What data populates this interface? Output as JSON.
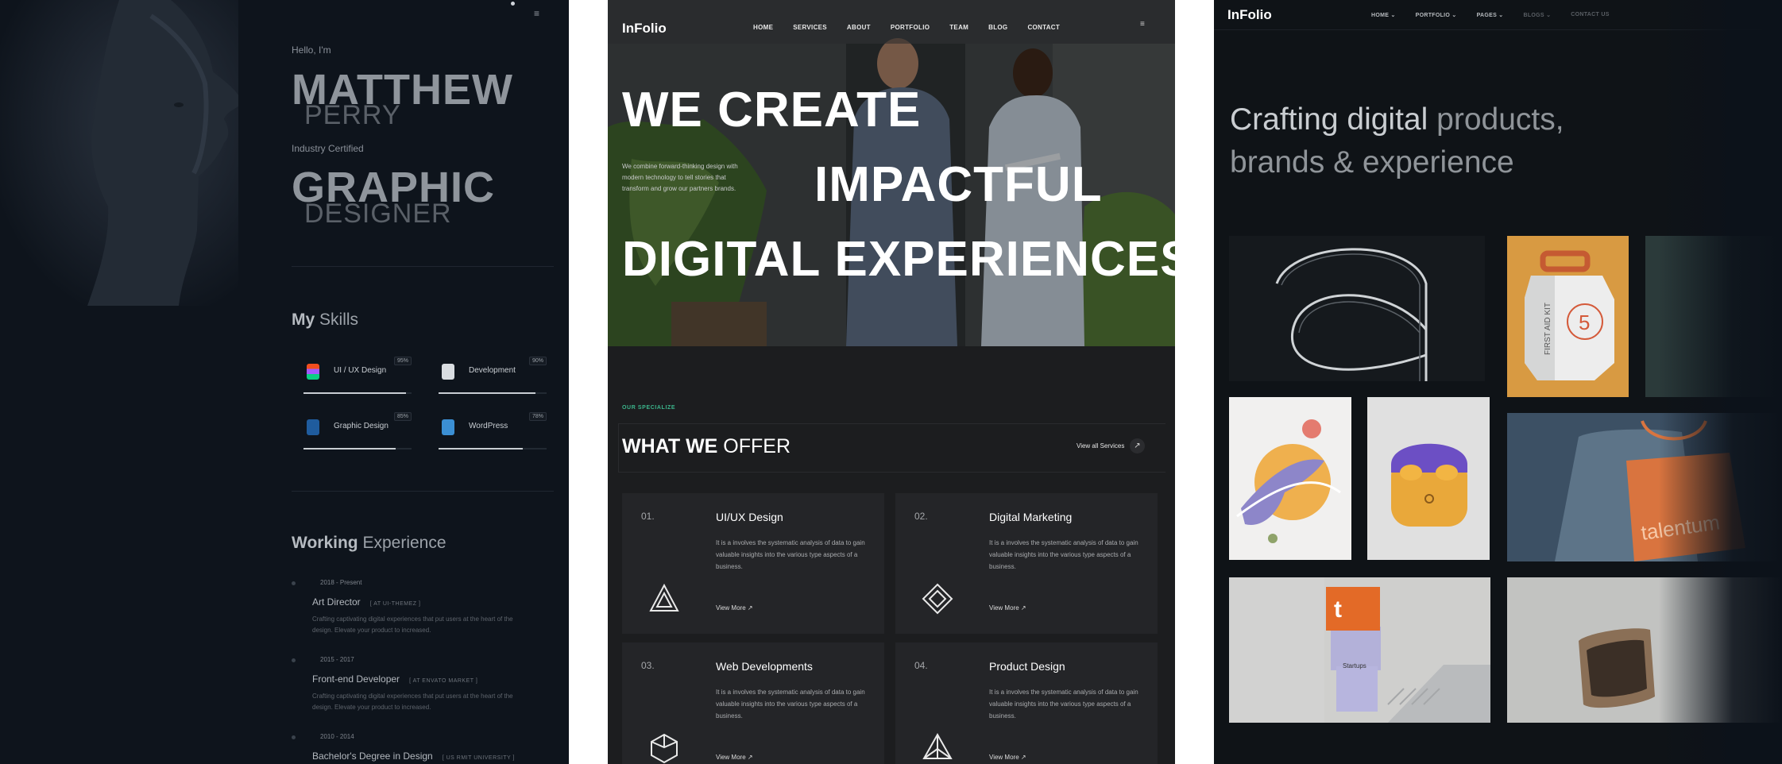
{
  "panel1": {
    "hello": "Hello, I'm",
    "name_first": "MATTHEW",
    "name_last": "PERRY",
    "cert": "Industry Certified",
    "role_first": "GRAPHIC",
    "role_last": "DESIGNER",
    "skills_title_bold": "My",
    "skills_title_rest": "Skills",
    "skills": [
      {
        "label": "UI / UX Design",
        "percent": "95%",
        "level": 0.95,
        "icon": "figma-icon"
      },
      {
        "label": "Development",
        "percent": "90%",
        "level": 0.9,
        "icon": "code-icon"
      },
      {
        "label": "Graphic Design",
        "percent": "85%",
        "level": 0.85,
        "icon": "photoshop-icon"
      },
      {
        "label": "WordPress",
        "percent": "78%",
        "level": 0.78,
        "icon": "wordpress-icon"
      }
    ],
    "exp_title_bold": "Working",
    "exp_title_rest": "Experience",
    "experience": [
      {
        "period": "2018 - Present",
        "title": "Art Director",
        "at": "[ AT UI-THEMEZ ]",
        "desc": "Crafting captivating digital experiences that put users at the heart of the design. Elevate your product to increased."
      },
      {
        "period": "2015 - 2017",
        "title": "Front-end Developer",
        "at": "[ AT ENVATO MARKET ]",
        "desc": "Crafting captivating digital experiences that put users at the heart of the design. Elevate your product to increased."
      },
      {
        "period": "2010 - 2014",
        "title": "Bachelor's Degree in Design",
        "at": "[ US RMIT UNIVERSITY ]",
        "desc": ""
      }
    ]
  },
  "panel2": {
    "logo": "InFolio",
    "nav": [
      "HOME",
      "SERVICES",
      "ABOUT",
      "PORTFOLIO",
      "TEAM",
      "BLOG",
      "CONTACT"
    ],
    "hero_line1": "WE CREATE",
    "hero_line2": "IMPACTFUL",
    "hero_line3": "DIGITAL EXPERIENCES",
    "hero_desc": "We combine forward-thinking design with modern technology to tell stories that transform and grow our partners brands.",
    "specialize": "OUR SPECIALIZE",
    "offer_bold": "WHAT WE",
    "offer_rest": "OFFER",
    "view_all": "View all Services",
    "services": [
      {
        "num": "01.",
        "title": "UI/UX Design",
        "desc": "It is a involves the systematic analysis of data to gain valuable insights into the various type aspects of a business.",
        "more": "View More"
      },
      {
        "num": "02.",
        "title": "Digital Marketing",
        "desc": "It is a involves the systematic analysis of data to gain valuable insights into the various type aspects of a business.",
        "more": "View More"
      },
      {
        "num": "03.",
        "title": "Web Developments",
        "desc": "It is a involves the systematic analysis of data to gain valuable insights into the various type aspects of a business.",
        "more": "View More"
      },
      {
        "num": "04.",
        "title": "Product Design",
        "desc": "It is a involves the systematic analysis of data to gain valuable insights into the various type aspects of a business.",
        "more": "View More"
      }
    ]
  },
  "panel3": {
    "logo": "InFolio",
    "nav": [
      "HOME ⌄",
      "PORTFOLIO ⌄",
      "PAGES ⌄",
      "BLOGS ⌄",
      "CONTACT US"
    ],
    "headline1_a": "Crafting digital",
    "headline1_b": "products,",
    "headline2": "brands & experience",
    "tiles": {
      "kit_text": "FIRST AID KIT",
      "kit_num": "5",
      "bag_text": "talentum",
      "cube_letter": "t",
      "cube_label": "Startups"
    }
  }
}
